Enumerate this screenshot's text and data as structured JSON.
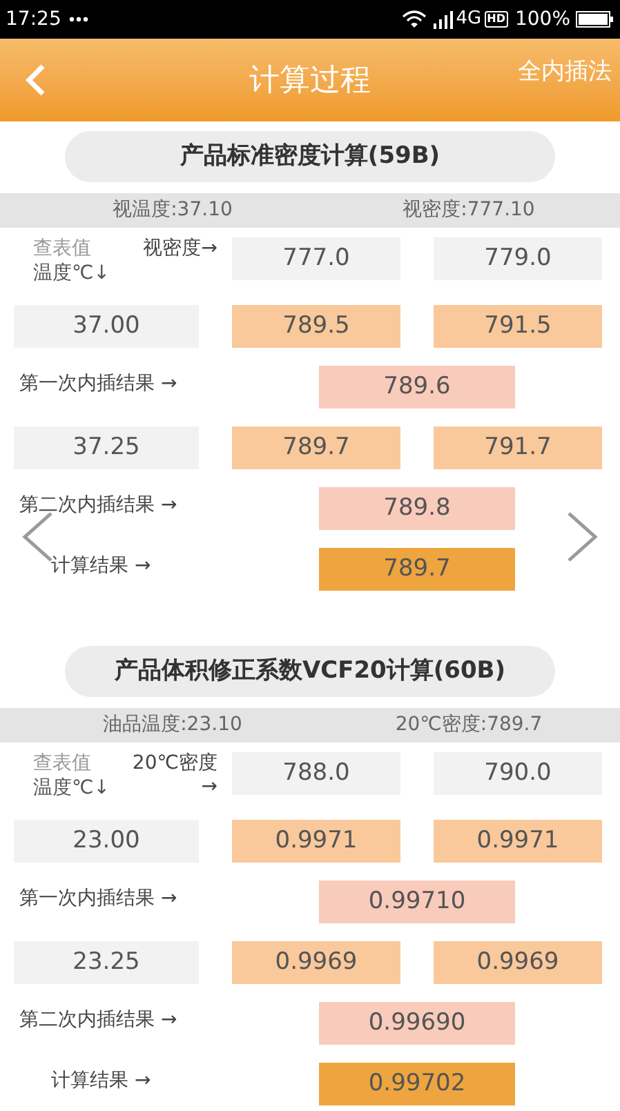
{
  "status_bar": {
    "time": "17:25",
    "network": "4G",
    "hd": "HD",
    "battery": "100%"
  },
  "header": {
    "title": "计算过程",
    "action": "全内插法"
  },
  "sections": [
    {
      "title": "产品标准密度计算(59B)",
      "info": [
        "视温度:37.10",
        "视密度:777.10"
      ],
      "table_header": {
        "corner_top": "查表值",
        "corner_bottom": "温度℃↓",
        "column_label": "视密度→",
        "columns": [
          "777.0",
          "779.0"
        ]
      },
      "rows": [
        {
          "kind": "data",
          "label": "37.00",
          "values": [
            "789.5",
            "791.5"
          ]
        },
        {
          "kind": "result",
          "label": "第一次内插结果 →",
          "value": "789.6"
        },
        {
          "kind": "data",
          "label": "37.25",
          "values": [
            "789.7",
            "791.7"
          ]
        },
        {
          "kind": "result",
          "label": "第二次内插结果 →",
          "value": "789.8"
        },
        {
          "kind": "final",
          "label": "计算结果 →",
          "value": "789.7"
        }
      ]
    },
    {
      "title": "产品体积修正系数VCF20计算(60B)",
      "info": [
        "油品温度:23.10",
        "20℃密度:789.7"
      ],
      "table_header": {
        "corner_top": "查表值",
        "corner_bottom": "温度℃↓",
        "column_label": "20℃密度 →",
        "columns": [
          "788.0",
          "790.0"
        ]
      },
      "rows": [
        {
          "kind": "data",
          "label": "23.00",
          "values": [
            "0.9971",
            "0.9971"
          ]
        },
        {
          "kind": "result",
          "label": "第一次内插结果 →",
          "value": "0.99710"
        },
        {
          "kind": "data",
          "label": "23.25",
          "values": [
            "0.9969",
            "0.9969"
          ]
        },
        {
          "kind": "result",
          "label": "第二次内插结果 →",
          "value": "0.99690"
        },
        {
          "kind": "final",
          "label": "计算结果 →",
          "value": "0.99702"
        }
      ]
    }
  ]
}
